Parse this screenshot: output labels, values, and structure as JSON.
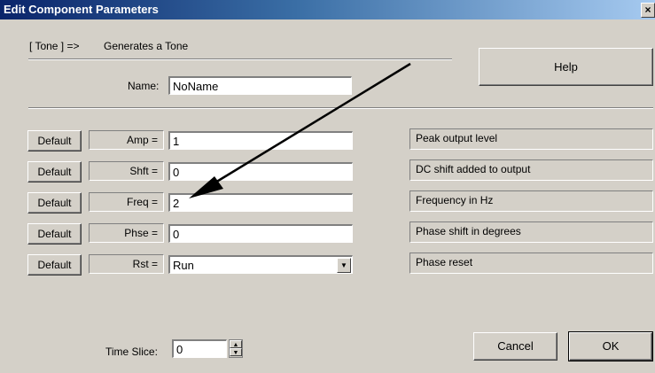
{
  "window": {
    "title": "Edit Component Parameters",
    "close_glyph": "×"
  },
  "header": {
    "component_tag": "[ Tone ] =>",
    "component_desc": "Generates a Tone"
  },
  "help_label": "Help",
  "name": {
    "label": "Name:",
    "value": "NoName"
  },
  "params": [
    {
      "default_label": "Default",
      "label": "Amp =",
      "value": "1",
      "desc": "Peak output level"
    },
    {
      "default_label": "Default",
      "label": "Shft =",
      "value": "0",
      "desc": "DC shift added to output"
    },
    {
      "default_label": "Default",
      "label": "Freq =",
      "value": "2",
      "desc": "Frequency in Hz"
    },
    {
      "default_label": "Default",
      "label": "Phse =",
      "value": "0",
      "desc": "Phase shift in degrees"
    },
    {
      "default_label": "Default",
      "label": "Rst =",
      "value": "Run",
      "desc": "Phase reset"
    }
  ],
  "time_slice": {
    "label": "Time Slice:",
    "value": "0"
  },
  "buttons": {
    "cancel": "Cancel",
    "ok": "OK"
  },
  "colors": {
    "face": "#d4d0c8",
    "title_start": "#0a246a",
    "title_end": "#a6caf0",
    "arrow": "#000000"
  },
  "icons": {
    "close": "close-icon",
    "dropdown": "chevron-down-icon",
    "spin": "spin-updown-icon"
  }
}
